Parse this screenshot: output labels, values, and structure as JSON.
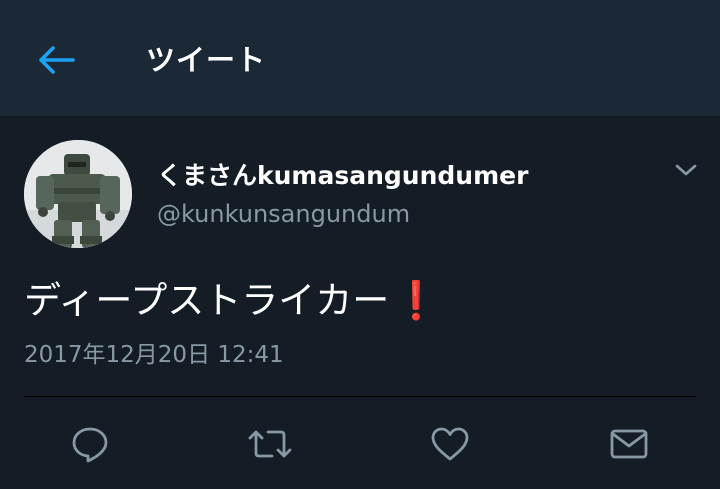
{
  "header": {
    "back_icon": "arrow-left-icon",
    "title": "ツイート",
    "accent_color": "#1da1f2"
  },
  "tweet": {
    "display_name": "くまさんkumasangundumer",
    "username": "@kunkunsangundum",
    "text": "ディープストライカー",
    "emoji": "❗",
    "timestamp": "2017年12月20日 12:41",
    "menu_icon": "chevron-down-icon"
  },
  "actions": [
    {
      "name": "reply",
      "icon": "reply-icon"
    },
    {
      "name": "retweet",
      "icon": "retweet-icon"
    },
    {
      "name": "like",
      "icon": "heart-icon"
    },
    {
      "name": "direct-message",
      "icon": "envelope-icon"
    }
  ],
  "colors": {
    "background": "#141d26",
    "header_background": "#1b2836",
    "secondary_text": "#8899a6",
    "primary_text": "#ffffff"
  }
}
